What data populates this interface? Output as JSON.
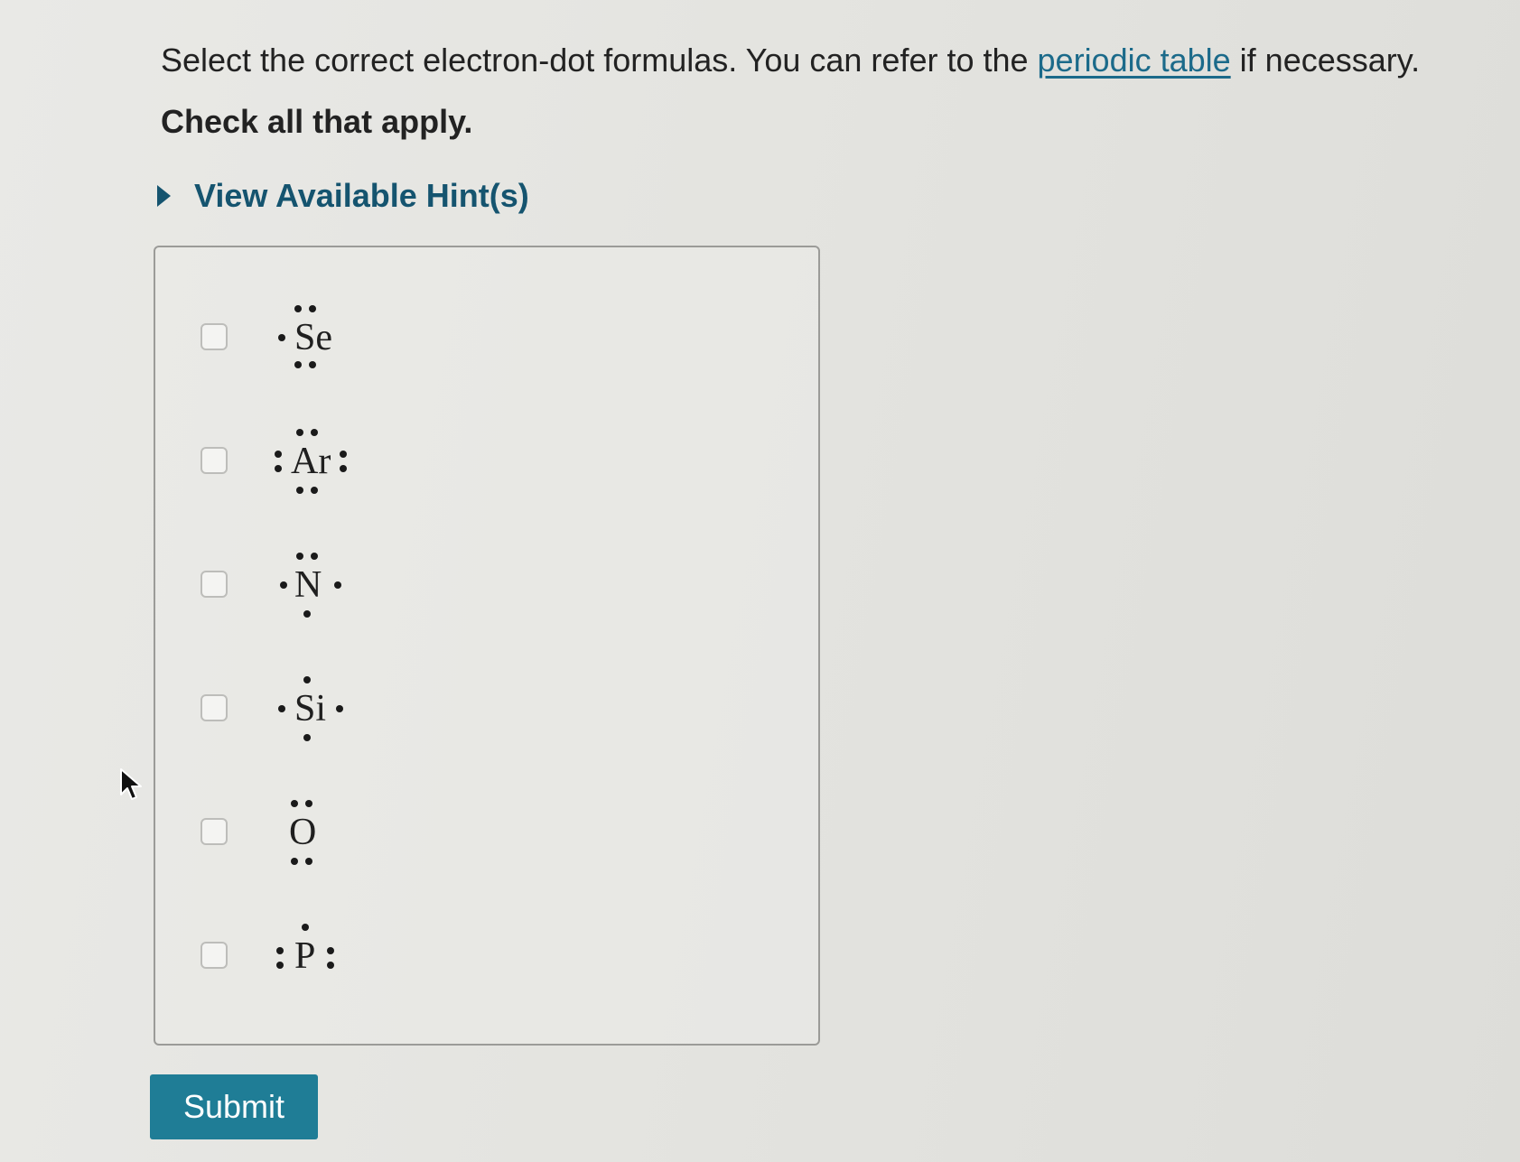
{
  "question": {
    "prompt_before_link": "Select the correct electron-dot formulas. You can refer to the ",
    "link_text": "periodic table",
    "prompt_after_link": " if necessary.",
    "instruction": "Check all that apply."
  },
  "hints": {
    "label": "View Available Hint(s)",
    "icon": "triangle-right-icon"
  },
  "options": [
    {
      "symbol": "Se",
      "checked": false
    },
    {
      "symbol": "Ar",
      "checked": false
    },
    {
      "symbol": "N",
      "checked": false
    },
    {
      "symbol": "Si",
      "checked": false
    },
    {
      "symbol": "O",
      "checked": false
    },
    {
      "symbol": "P",
      "checked": false
    }
  ],
  "submit": {
    "label": "Submit"
  },
  "colors": {
    "link": "#1b6a8a",
    "hint": "#15546f",
    "button": "#1f7d96"
  }
}
